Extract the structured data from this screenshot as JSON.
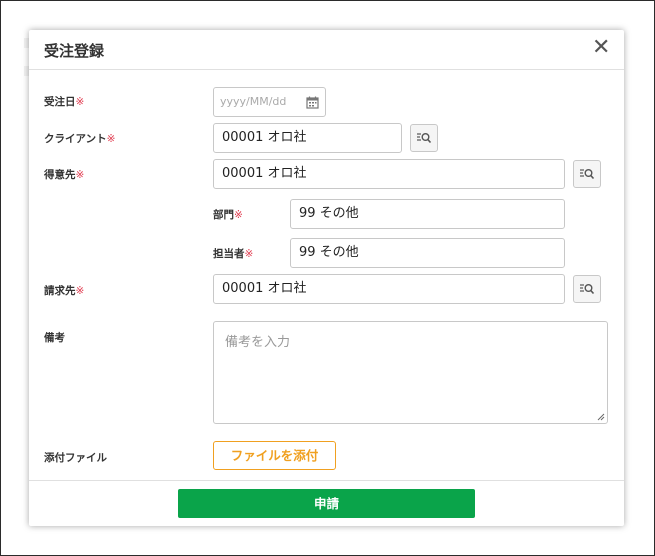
{
  "dialog": {
    "title": "受注登録",
    "close_icon": "close-icon"
  },
  "form": {
    "required_mark": "※",
    "order_date": {
      "label": "受注日",
      "placeholder": "yyyy/MM/dd",
      "icon": "calendar-icon"
    },
    "client": {
      "label": "クライアント",
      "value": "00001 オロ社"
    },
    "customer": {
      "label": "得意先",
      "value": "00001 オロ社"
    },
    "department": {
      "label": "部門",
      "value": "99 その他"
    },
    "person_in_charge": {
      "label": "担当者",
      "value": "99 その他"
    },
    "billing": {
      "label": "請求先",
      "value": "00001 オロ社"
    },
    "remarks": {
      "label": "備考",
      "placeholder": "備考を入力"
    },
    "attachment": {
      "label": "添付ファイル",
      "button_label": "ファイルを添付"
    }
  },
  "footer": {
    "submit_label": "申請"
  },
  "colors": {
    "required": "#e03a4e",
    "attach_accent": "#f0a020",
    "submit_bg": "#0aa44a"
  }
}
